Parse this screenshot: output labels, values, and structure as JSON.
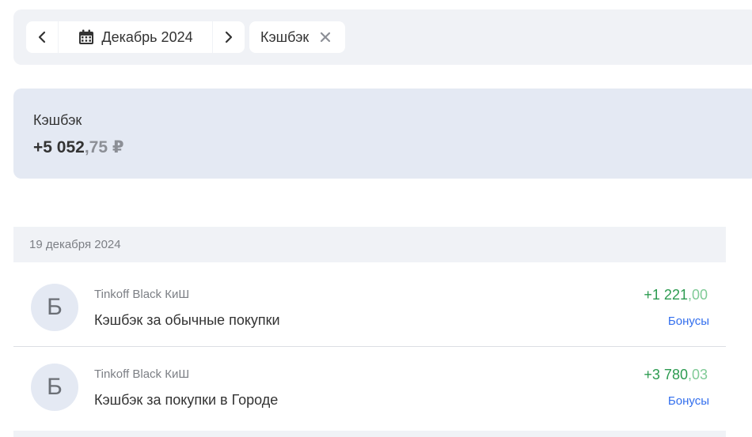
{
  "filter": {
    "month_label": "Декабрь 2024",
    "chip_label": "Кэшбэк",
    "icons": {
      "prev": "chevron-left-icon",
      "calendar": "calendar-icon",
      "next": "chevron-right-icon",
      "close": "close-icon"
    }
  },
  "summary": {
    "label": "Кэшбэк",
    "amount_int": "+5 052",
    "amount_frac": ",75 ₽"
  },
  "date_group": {
    "date": "19 декабря 2024"
  },
  "operations": [
    {
      "avatar_letter": "Б",
      "account": "Tinkoff Black КиШ",
      "description": "Кэшбэк за обычные покупки",
      "amount_int": "+1 221",
      "amount_frac": ",00",
      "tag": "Бонусы"
    },
    {
      "avatar_letter": "Б",
      "account": "Tinkoff Black КиШ",
      "description": "Кэшбэк за покупки в Городе",
      "amount_int": "+3 780",
      "amount_frac": ",03",
      "tag": "Бонусы"
    }
  ],
  "colors": {
    "positive": "#2c9b50",
    "positive_fraction": "#7fca96",
    "link": "#336fee",
    "summary_bg": "#e4e9f3",
    "bar_bg": "#f0f2f6"
  }
}
